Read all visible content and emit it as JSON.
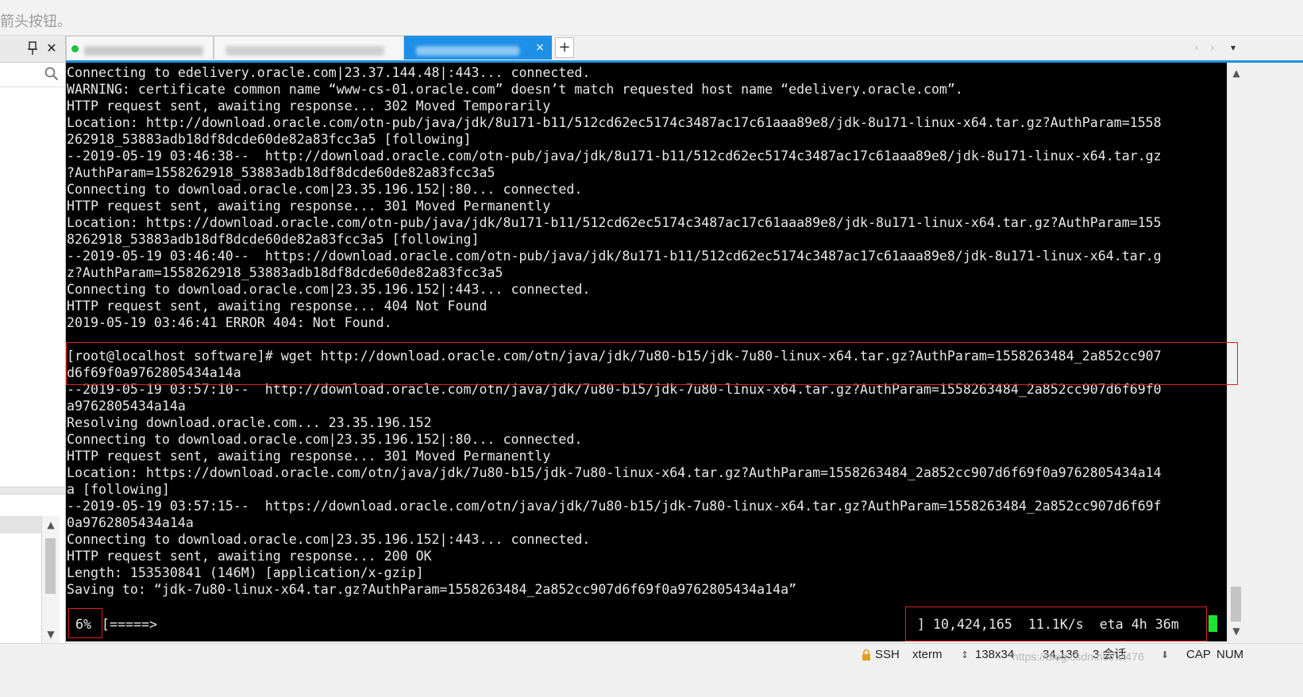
{
  "top_hint": "箭头按钮。",
  "tabs": {
    "add_label": "+",
    "close_label": "×",
    "nav_left": "‹",
    "nav_right": "›",
    "nav_menu": "▾"
  },
  "terminal": {
    "lines": [
      "Connecting to edelivery.oracle.com|23.37.144.48|:443... connected.",
      "WARNING: certificate common name “www-cs-01.oracle.com” doesn’t match requested host name “edelivery.oracle.com”.",
      "HTTP request sent, awaiting response... 302 Moved Temporarily",
      "Location: http://download.oracle.com/otn-pub/java/jdk/8u171-b11/512cd62ec5174c3487ac17c61aaa89e8/jdk-8u171-linux-x64.tar.gz?AuthParam=1558",
      "262918_53883adb18df8dcde60de82a83fcc3a5 [following]",
      "--2019-05-19 03:46:38--  http://download.oracle.com/otn-pub/java/jdk/8u171-b11/512cd62ec5174c3487ac17c61aaa89e8/jdk-8u171-linux-x64.tar.gz",
      "?AuthParam=1558262918_53883adb18df8dcde60de82a83fcc3a5",
      "Connecting to download.oracle.com|23.35.196.152|:80... connected.",
      "HTTP request sent, awaiting response... 301 Moved Permanently",
      "Location: https://download.oracle.com/otn-pub/java/jdk/8u171-b11/512cd62ec5174c3487ac17c61aaa89e8/jdk-8u171-linux-x64.tar.gz?AuthParam=155",
      "8262918_53883adb18df8dcde60de82a83fcc3a5 [following]",
      "--2019-05-19 03:46:40--  https://download.oracle.com/otn-pub/java/jdk/8u171-b11/512cd62ec5174c3487ac17c61aaa89e8/jdk-8u171-linux-x64.tar.g",
      "z?AuthParam=1558262918_53883adb18df8dcde60de82a83fcc3a5",
      "Connecting to download.oracle.com|23.35.196.152|:443... connected.",
      "HTTP request sent, awaiting response... 404 Not Found",
      "2019-05-19 03:46:41 ERROR 404: Not Found.",
      "",
      "[root@localhost software]# wget http://download.oracle.com/otn/java/jdk/7u80-b15/jdk-7u80-linux-x64.tar.gz?AuthParam=1558263484_2a852cc907",
      "d6f69f0a9762805434a14a",
      "--2019-05-19 03:57:10--  http://download.oracle.com/otn/java/jdk/7u80-b15/jdk-7u80-linux-x64.tar.gz?AuthParam=1558263484_2a852cc907d6f69f0",
      "a9762805434a14a",
      "Resolving download.oracle.com... 23.35.196.152",
      "Connecting to download.oracle.com|23.35.196.152|:80... connected.",
      "HTTP request sent, awaiting response... 301 Moved Permanently",
      "Location: https://download.oracle.com/otn/java/jdk/7u80-b15/jdk-7u80-linux-x64.tar.gz?AuthParam=1558263484_2a852cc907d6f69f0a9762805434a14",
      "a [following]",
      "--2019-05-19 03:57:15--  https://download.oracle.com/otn/java/jdk/7u80-b15/jdk-7u80-linux-x64.tar.gz?AuthParam=1558263484_2a852cc907d6f69f",
      "0a9762805434a14a",
      "Connecting to download.oracle.com|23.35.196.152|:443... connected.",
      "HTTP request sent, awaiting response... 200 OK",
      "Length: 153530841 (146M) [application/x-gzip]",
      "Saving to: “jdk-7u80-linux-x64.tar.gz?AuthParam=1558263484_2a852cc907d6f69f0a9762805434a14a”"
    ],
    "progress_percent": "6%",
    "progress_bar": "[=====>",
    "progress_stats": "] 10,424,165  11.1K/s  eta 4h 36m"
  },
  "statusbar": {
    "protocol": "SSH",
    "terminal_type": "xterm",
    "size": "138x34",
    "cursor_pos": "34,136",
    "sessions": "3 会话",
    "watermark": "https://blog.csdn.net/wl476",
    "caps": "CAP",
    "num": "NUM"
  },
  "colors": {
    "accent": "#1e90e8",
    "terminal_bg": "#000000",
    "terminal_fg": "#e8e8e8",
    "highlight_box": "#e02020",
    "cursor": "#20e030"
  }
}
